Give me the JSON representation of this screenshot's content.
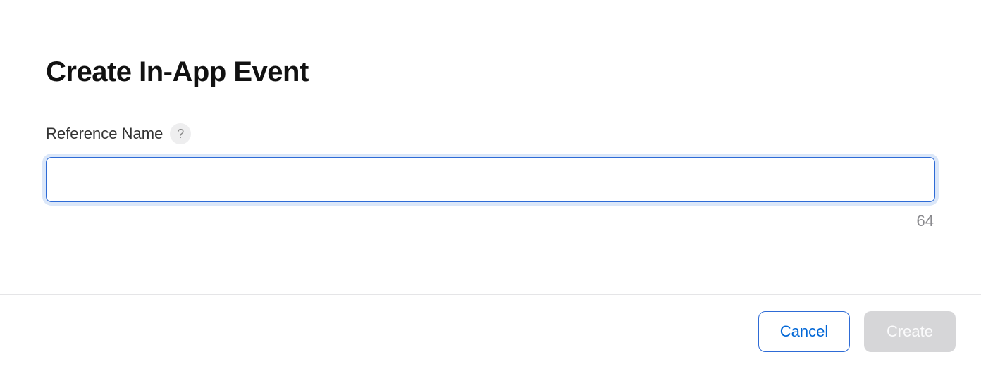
{
  "dialog": {
    "title": "Create In-App Event",
    "field": {
      "label": "Reference Name",
      "help_symbol": "?",
      "value": "",
      "char_remaining": "64"
    },
    "buttons": {
      "cancel": "Cancel",
      "create": "Create"
    }
  }
}
